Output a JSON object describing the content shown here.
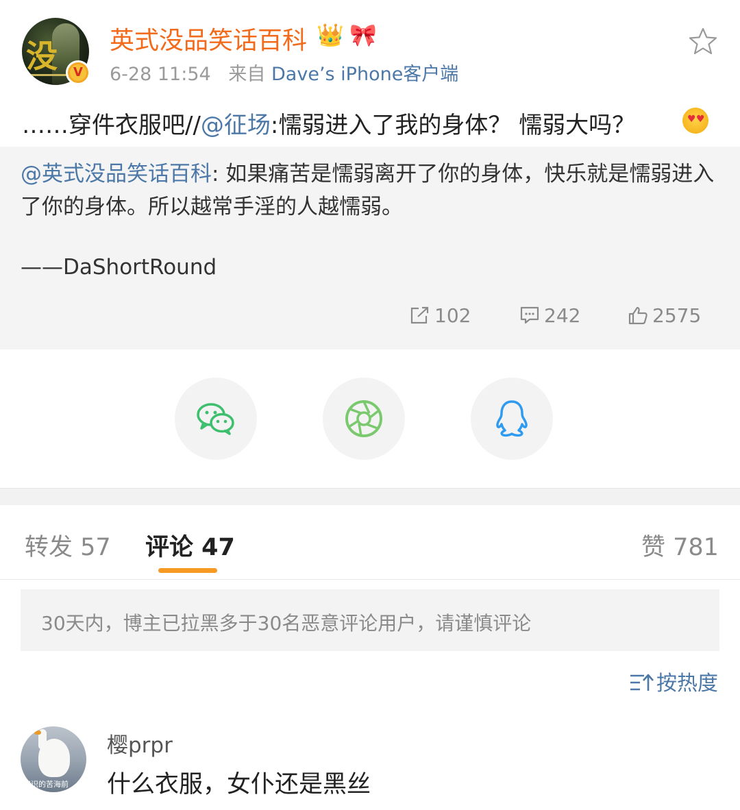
{
  "post": {
    "username": "英式没品笑话百科",
    "avatar_text": "没",
    "badges": [
      "crown-icon",
      "bow-icon"
    ],
    "time": "6-28 11:54",
    "source_prefix": "来自",
    "source": "Dave’s iPhone客户端",
    "text_part1": "……穿件衣服吧//",
    "text_mention": "@征场",
    "text_part2": ":懦弱进入了我的身体？ 懦弱大吗？",
    "emoji": "heart-eyes-emoji"
  },
  "quote": {
    "mention": "@英式没品笑话百科",
    "text": ": 如果痛苦是懦弱离开了你的身体，快乐就是懦弱进入了你的身体。所以越常手淫的人越懦弱。",
    "signature": "——DaShortRound",
    "reposts": "102",
    "comments": "242",
    "likes": "2575"
  },
  "share": {
    "items": [
      "wechat",
      "moments",
      "qq"
    ]
  },
  "tabs": {
    "repost": "转发 57",
    "comment": "评论 47",
    "like": "赞 781",
    "active": "comment"
  },
  "notice": "30天内，博主已拉黑多于30名恶意评论用户，请谨慎评论",
  "sort_label": "按热度",
  "comment": {
    "username": "樱prpr",
    "avatar_watermark": "知识的苦海前",
    "text": "什么衣服，女仆还是黑丝"
  },
  "colors": {
    "username": "#f26b1d",
    "link": "#4c78a8",
    "tab_underline": "#f69a23",
    "wechat": "#3dbf6e",
    "moments": "#7bc96f",
    "qq": "#2e9bf0"
  }
}
